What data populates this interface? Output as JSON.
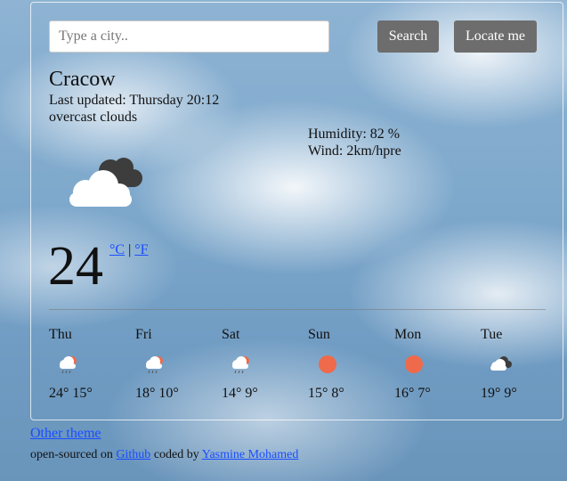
{
  "search": {
    "placeholder": "Type a city..",
    "value": ""
  },
  "buttons": {
    "search": "Search",
    "locate": "Locate me"
  },
  "current": {
    "city": "Cracow",
    "last_updated": "Last updated: Thursday 20:12",
    "description": "overcast clouds",
    "humidity": "Humidity: 82 %",
    "wind": "Wind: 2km/hpre",
    "temperature": "24",
    "icon": "overcast-clouds-icon",
    "unit_celsius": "°C",
    "unit_separator": "|",
    "unit_fahrenheit": "°F"
  },
  "forecast": [
    {
      "day": "Thu",
      "range": "24° 15°",
      "icon": "rain-cloud-icon"
    },
    {
      "day": "Fri",
      "range": "18° 10°",
      "icon": "rain-cloud-icon"
    },
    {
      "day": "Sat",
      "range": "14° 9°",
      "icon": "rain-cloud-icon"
    },
    {
      "day": "Sun",
      "range": "15° 8°",
      "icon": "sun-icon"
    },
    {
      "day": "Mon",
      "range": "16° 7°",
      "icon": "sun-icon"
    },
    {
      "day": "Tue",
      "range": "19° 9°",
      "icon": "cloudy-icon"
    }
  ],
  "footer": {
    "theme_link": "Other theme",
    "credit_prefix": "open-sourced on",
    "github_link": "Github",
    "credit_middle": "coded by",
    "author_link": "Yasmine Mohamed"
  },
  "colors": {
    "button": "#6d6d6d",
    "sun": "#ee6a4b",
    "link": "#1a4dff"
  }
}
